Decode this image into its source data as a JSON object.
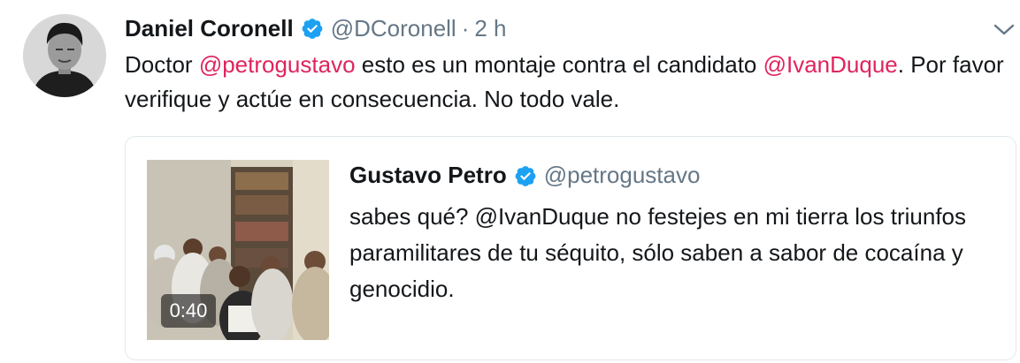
{
  "tweet": {
    "author_name": "Daniel Coronell",
    "author_handle": "@DCoronell",
    "separator": "·",
    "time": "2 h",
    "text_parts": {
      "p1": "Doctor ",
      "m1": "@petrogustavo",
      "p2": " esto es un montaje contra el candidato ",
      "m2": "@IvanDuque",
      "p3": ". Por favor verifique y actúe en consecuencia. No todo vale."
    },
    "icons": {
      "verified": "verified-badge-icon",
      "menu": "chevron-down-icon"
    }
  },
  "quoted_tweet": {
    "author_name": "Gustavo Petro",
    "author_handle": "@petrogustavo",
    "text": "sabes qué? @IvanDuque no festejes en mi tierra los triunfos paramilitares de tu séquito, sólo saben a sabor de cocaína y genocidio.",
    "video_duration": "0:40"
  },
  "colors": {
    "mention": "#e0245e",
    "verified": "#1da1f2",
    "secondary_text": "#657786",
    "border": "#e1e8ed"
  }
}
